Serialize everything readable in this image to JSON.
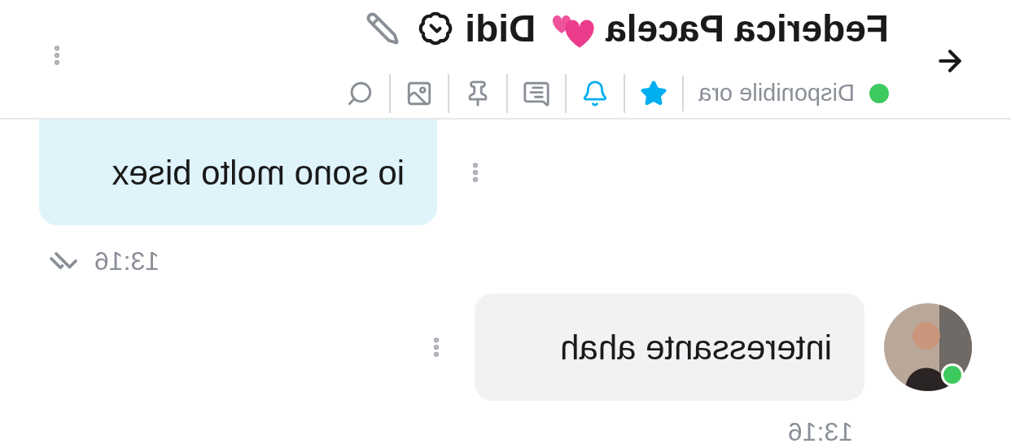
{
  "header": {
    "name": "Federica Pacela",
    "nickname": "Didi",
    "verified": true,
    "status": "Disponibile ora",
    "online": true,
    "toolbar": [
      {
        "kind": "star",
        "active": true
      },
      {
        "kind": "bell",
        "active": true
      },
      {
        "kind": "note",
        "active": false
      },
      {
        "kind": "pin",
        "active": false
      },
      {
        "kind": "image",
        "active": false
      },
      {
        "kind": "search",
        "active": false
      }
    ]
  },
  "messages": [
    {
      "kind": "sent",
      "text": "io sono molto bisex",
      "time": "13:16",
      "read": true
    },
    {
      "kind": "received",
      "text": "interessante ahah",
      "time": "13:16",
      "online": true
    }
  ]
}
